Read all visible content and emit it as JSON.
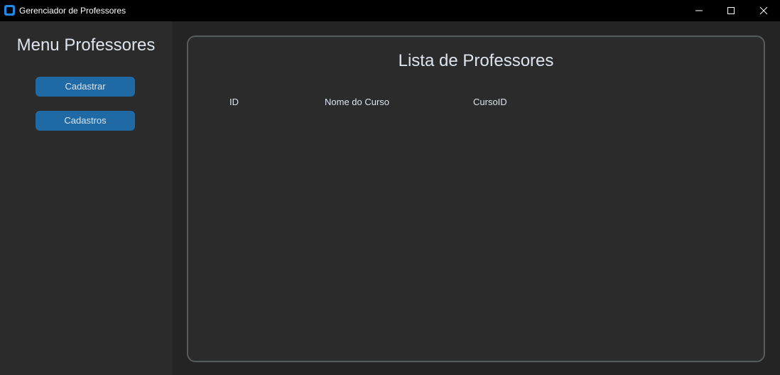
{
  "window": {
    "title": "Gerenciador de Professores"
  },
  "titlebar_icons": [
    "minimize-icon",
    "maximize-icon",
    "close-icon"
  ],
  "sidebar": {
    "title": "Menu Professores",
    "buttons": [
      {
        "label": "Cadastrar"
      },
      {
        "label": "Cadastros"
      }
    ]
  },
  "main": {
    "title": "Lista de Professores",
    "table": {
      "columns": [
        "ID",
        "Nome do Curso",
        "CursoID"
      ],
      "rows": []
    }
  },
  "colors": {
    "accent": "#1f6aa5",
    "background": "#242424",
    "panel": "#2b2b2b",
    "text": "#dce4ee",
    "border": "#565b5e"
  }
}
